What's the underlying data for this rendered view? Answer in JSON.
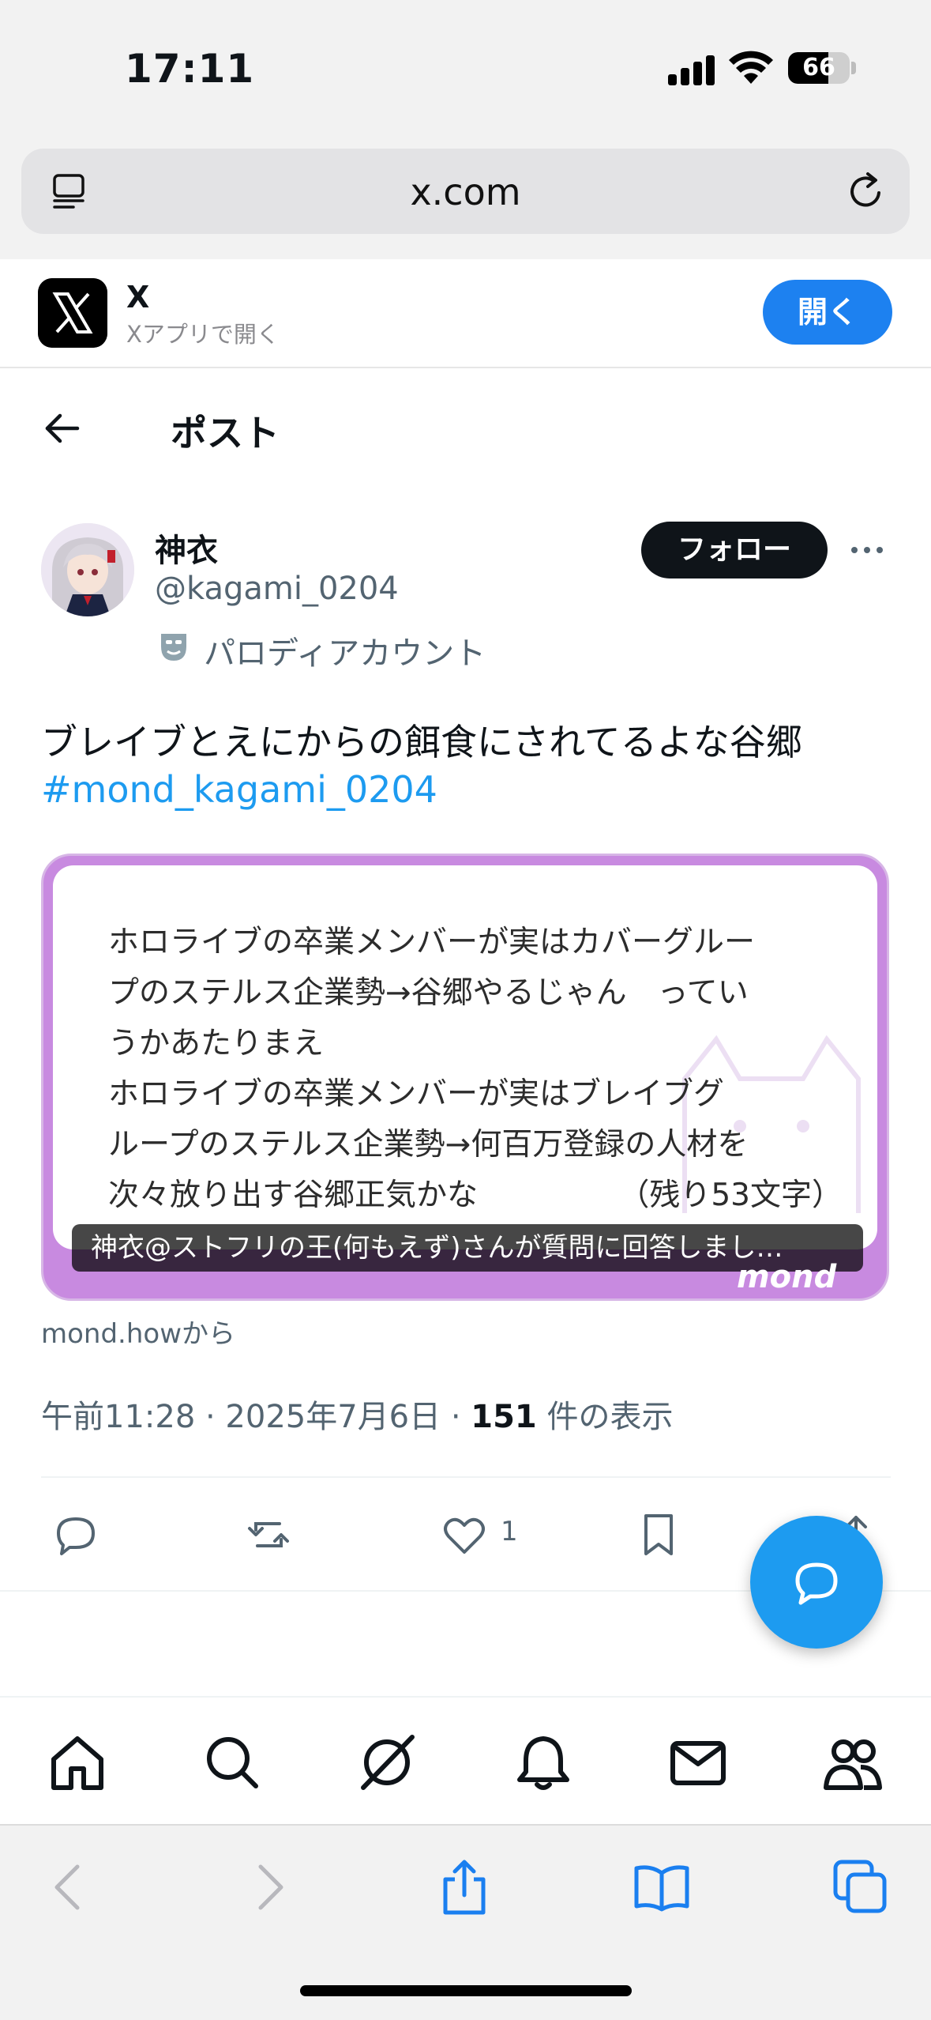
{
  "status_bar": {
    "time": "17:11",
    "battery": "66",
    "battery_level": 0.66
  },
  "browser": {
    "url": "x.com"
  },
  "app_banner": {
    "name": "X",
    "subtitle": "Xアプリで開く",
    "open_label": "開く"
  },
  "header": {
    "title": "ポスト"
  },
  "author": {
    "name": "神衣",
    "handle": "@kagami_0204",
    "parody_label": "パロディアカウント",
    "follow_label": "フォロー"
  },
  "post": {
    "text": "ブレイブとえにからの餌食にされてるよな谷郷",
    "hashtag": "#mond_kagami_0204",
    "card": {
      "lines": [
        "ホロライブの卒業メンバーが実はカバーグルー",
        "プのステルス企業勢→谷郷やるじゃん　ってい",
        "うかあたりまえ",
        "ホロライブの卒業メンバーが実はブレイブグ",
        "ループのステルス企業勢→何百万登録の人材を",
        "次々放り出す谷郷正気かな"
      ],
      "remaining": "（残り53文字）",
      "caption": "神衣@ストフリの王(何もえず)さんが質問に回答しまし…",
      "brand": "mond",
      "source": "mond.howから"
    },
    "meta": {
      "time_date": "午前11:28 · 2025年7月6日 · ",
      "views": "151",
      "views_suffix": " 件の表示"
    },
    "like_count": "1"
  },
  "colors": {
    "accent": "#1d9bf0",
    "card_purple": "#c88ae0",
    "open_button": "#1d81f0"
  },
  "icons": {
    "actions": [
      "reply-icon",
      "repost-icon",
      "like-icon",
      "bookmark-icon",
      "share-icon"
    ],
    "tabs": [
      "home-icon",
      "search-icon",
      "grok-icon",
      "notifications-icon",
      "messages-icon",
      "communities-icon"
    ],
    "toolbar": [
      "back-icon",
      "forward-icon",
      "share-icon",
      "bookmarks-icon",
      "tabs-icon"
    ]
  }
}
